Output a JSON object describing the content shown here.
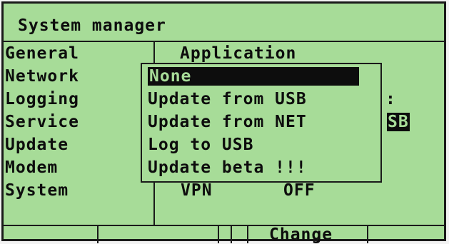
{
  "header": {
    "title": "System manager"
  },
  "sidebar": {
    "items": [
      {
        "label": "General"
      },
      {
        "label": "Network"
      },
      {
        "label": "Logging"
      },
      {
        "label": "Service"
      },
      {
        "label": "Update"
      },
      {
        "label": "Modem"
      },
      {
        "label": "System"
      }
    ]
  },
  "panel": {
    "title": "Application",
    "colon": ":",
    "highlight_value": "SB",
    "vpn_label": "VPN",
    "vpn_value": "OFF"
  },
  "popup": {
    "items": [
      {
        "label": "None",
        "selected": true
      },
      {
        "label": "Update from USB"
      },
      {
        "label": "Update from NET"
      },
      {
        "label": "Log to USB"
      },
      {
        "label": "Update beta !!!"
      }
    ]
  },
  "softkeys": {
    "change_label": "Change"
  },
  "colors": {
    "lcd_background": "#a7dc98",
    "lcd_foreground": "#0d0d0d"
  }
}
